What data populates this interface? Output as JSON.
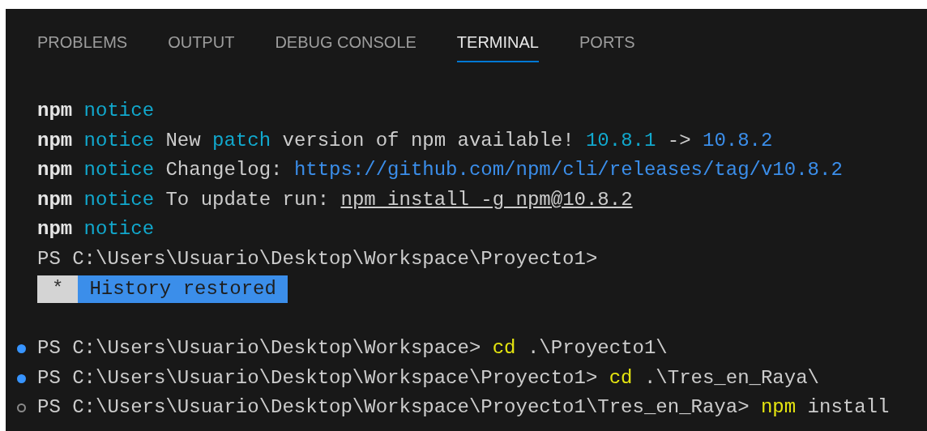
{
  "tabs": [
    {
      "label": "PROBLEMS",
      "selected": false
    },
    {
      "label": "OUTPUT",
      "selected": false
    },
    {
      "label": "DEBUG CONSOLE",
      "selected": false
    },
    {
      "label": "TERMINAL",
      "selected": true
    },
    {
      "label": "PORTS",
      "selected": false
    }
  ],
  "output_lines": [
    [
      {
        "kind": "bold",
        "text": "npm"
      },
      {
        "kind": "cyan",
        "text": " notice"
      }
    ],
    [
      {
        "kind": "bold",
        "text": "npm"
      },
      {
        "kind": "cyan",
        "text": " notice"
      },
      {
        "kind": "plain",
        "text": " New "
      },
      {
        "kind": "cyan",
        "text": "patch"
      },
      {
        "kind": "plain",
        "text": " version of npm available! "
      },
      {
        "kind": "cyan",
        "text": "10.8.1"
      },
      {
        "kind": "plain",
        "text": " -> "
      },
      {
        "kind": "blue",
        "text": "10.8.2"
      }
    ],
    [
      {
        "kind": "bold",
        "text": "npm"
      },
      {
        "kind": "cyan",
        "text": " notice"
      },
      {
        "kind": "plain",
        "text": " Changelog: "
      },
      {
        "kind": "link",
        "text": "https://github.com/npm/cli/releases/tag/v10.8.2"
      }
    ],
    [
      {
        "kind": "bold",
        "text": "npm"
      },
      {
        "kind": "cyan",
        "text": " notice"
      },
      {
        "kind": "plain",
        "text": " To update run: "
      },
      {
        "kind": "underline",
        "text": "npm install -g npm@10.8.2"
      }
    ],
    [
      {
        "kind": "bold",
        "text": "npm"
      },
      {
        "kind": "cyan",
        "text": " notice"
      }
    ],
    [
      {
        "kind": "plain",
        "text": "PS C:\\Users\\Usuario\\Desktop\\Workspace\\Proyecto1>"
      }
    ]
  ],
  "history_banner": {
    "marker": "*",
    "text": "History restored"
  },
  "commands": [
    {
      "completed": true,
      "prompt": "PS C:\\Users\\Usuario\\Desktop\\Workspace>",
      "command": "cd",
      "args": ".\\Proyecto1\\"
    },
    {
      "completed": true,
      "prompt": "PS C:\\Users\\Usuario\\Desktop\\Workspace\\Proyecto1>",
      "command": "cd",
      "args": ".\\Tres_en_Raya\\"
    },
    {
      "completed": false,
      "prompt": "PS C:\\Users\\Usuario\\Desktop\\Workspace\\Proyecto1\\Tres_en_Raya>",
      "command": "npm",
      "args": "install"
    }
  ]
}
